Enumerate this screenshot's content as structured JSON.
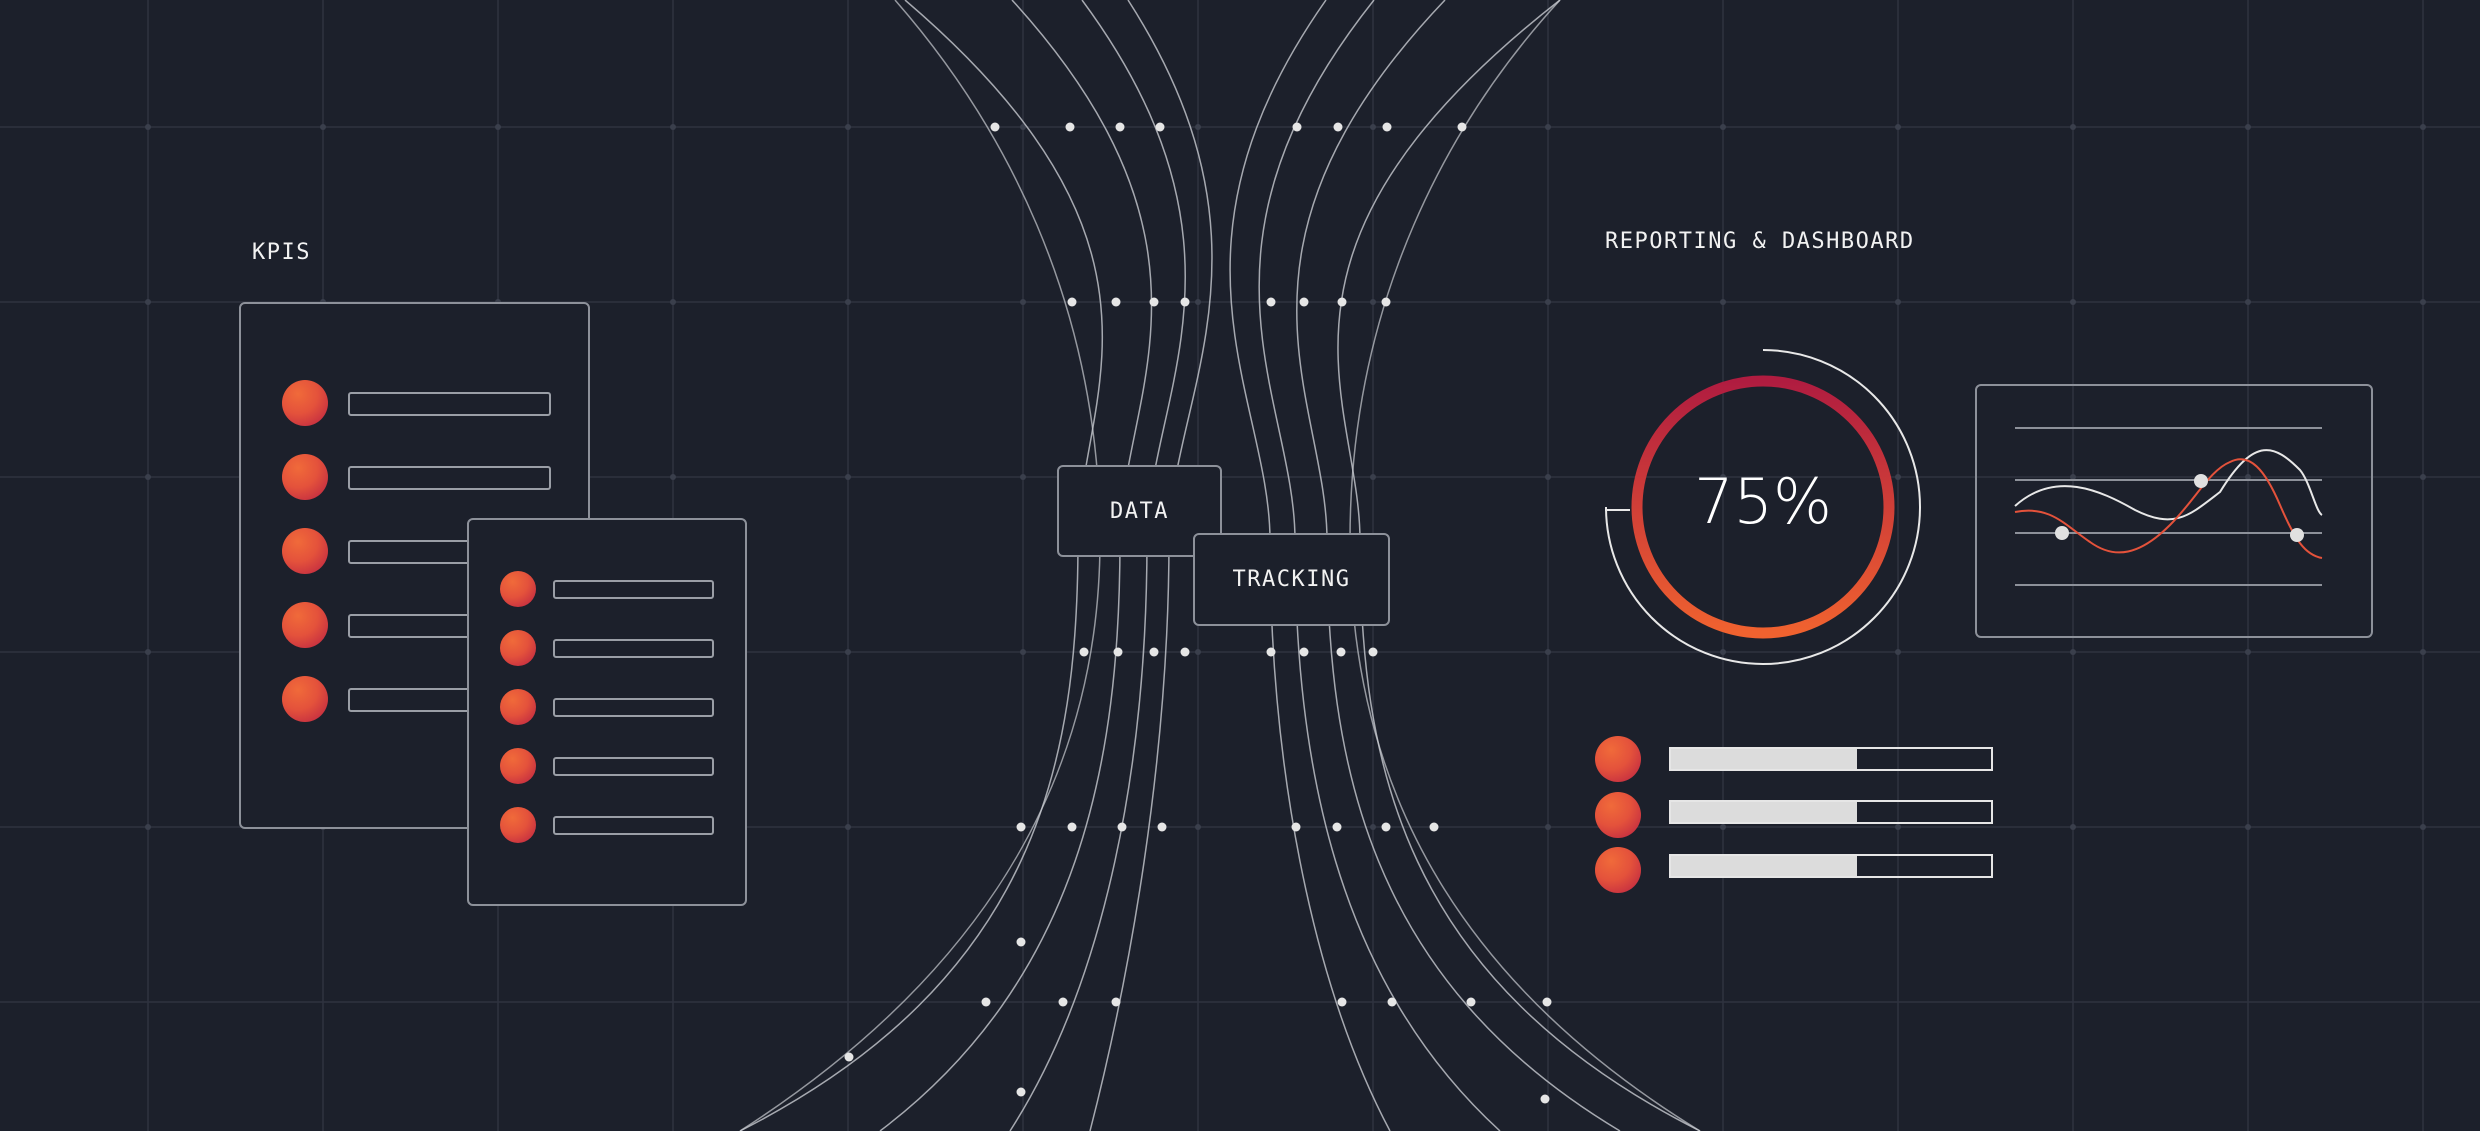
{
  "kpis": {
    "title": "KPIS",
    "back_card_rows": 5,
    "front_card_rows": 5
  },
  "hub": {
    "node_data": "DATA",
    "node_tracking": "TRACKING"
  },
  "reporting": {
    "title": "REPORTING & DASHBOARD",
    "donut_label": "75%",
    "donut_value": 0.75,
    "progress_bars": [
      {
        "fill": 0.58
      },
      {
        "fill": 0.58
      },
      {
        "fill": 0.58
      }
    ]
  },
  "colors": {
    "background": "#1c202b",
    "grid": "#2e3340",
    "line": "#c9ccd2",
    "accent_start": "#b81f43",
    "accent_end": "#f06a3a"
  }
}
